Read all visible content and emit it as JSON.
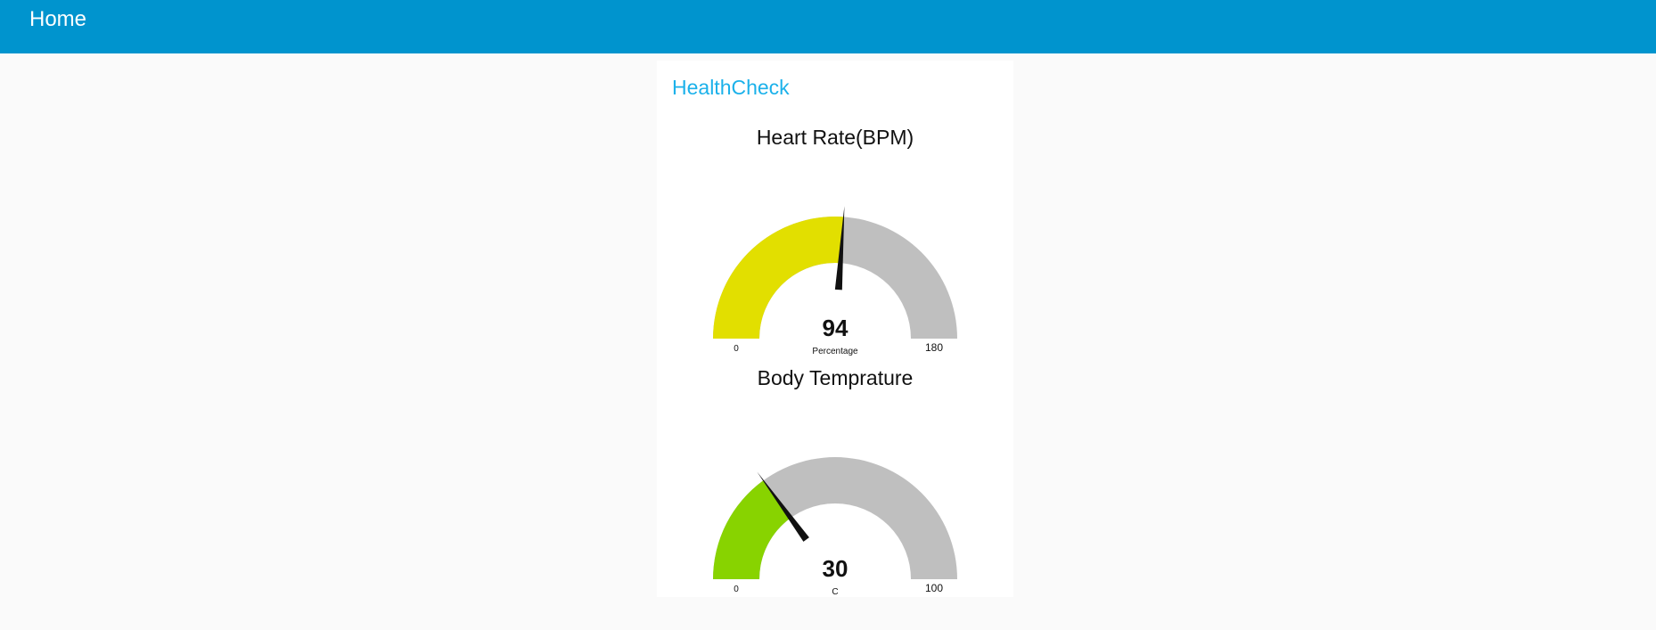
{
  "header": {
    "title": "Home"
  },
  "group": {
    "title": "HealthCheck"
  },
  "gauges": [
    {
      "title": "Heart Rate(BPM)",
      "value": 94,
      "value_label": "94",
      "units": "Percentage",
      "min": 0,
      "max": 180,
      "min_label": "0",
      "max_label": "180",
      "fill_color": "#e2df00",
      "track_color": "#bfbfbf",
      "needle_color": "#111111"
    },
    {
      "title": "Body Temprature",
      "value": 30,
      "value_label": "30",
      "units": "C",
      "min": 0,
      "max": 100,
      "min_label": "0",
      "max_label": "100",
      "fill_color": "#88d300",
      "track_color": "#bfbfbf",
      "needle_color": "#111111"
    }
  ]
}
